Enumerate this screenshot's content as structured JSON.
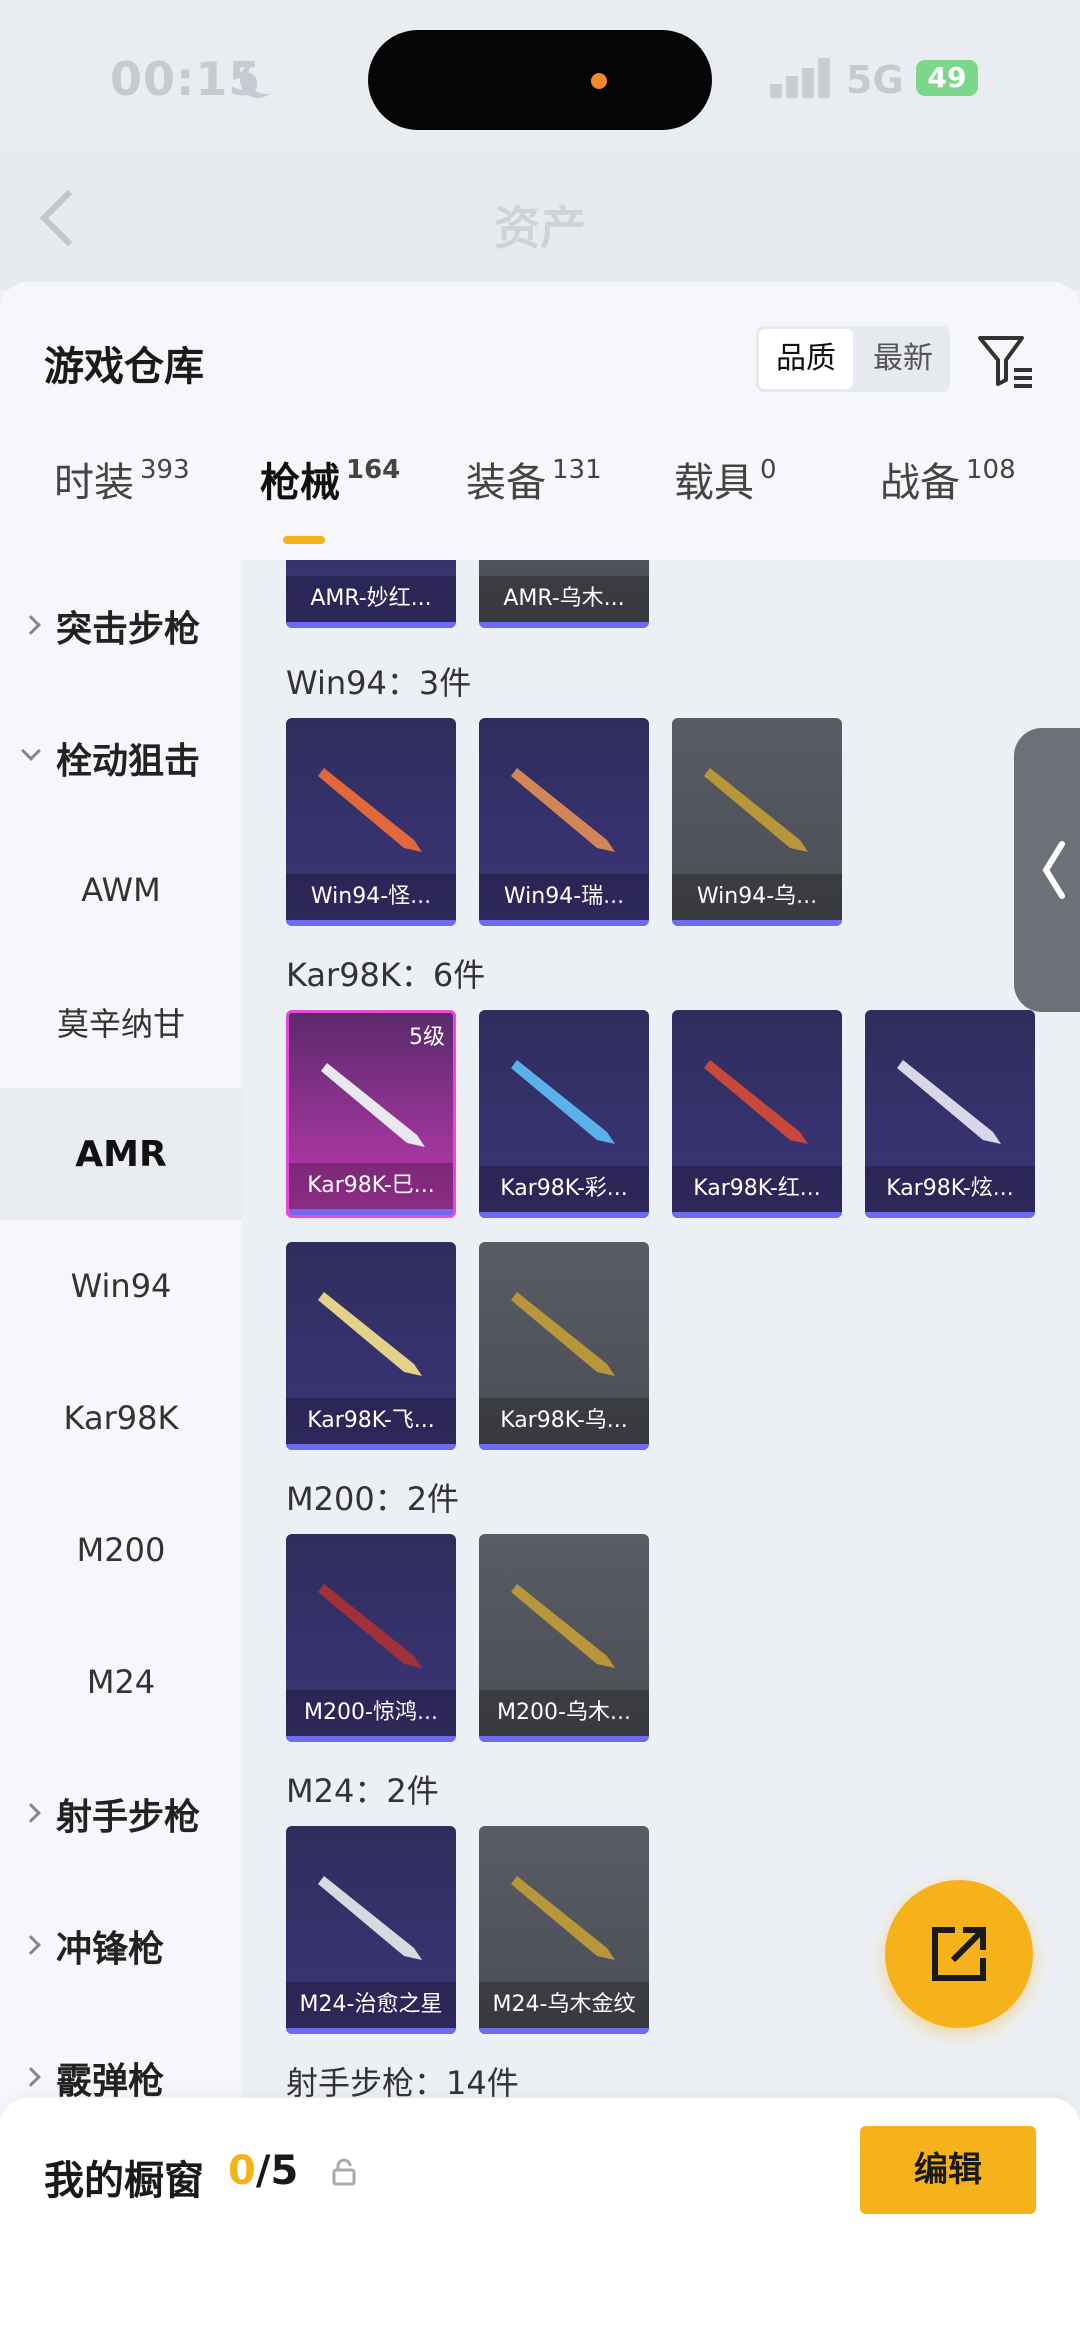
{
  "status": {
    "time": "00:15",
    "network": "5G",
    "battery": "49"
  },
  "header": {
    "title": "资产"
  },
  "sheet": {
    "title": "游戏仓库",
    "sort_options": [
      "品质",
      "最新"
    ]
  },
  "tabs": [
    {
      "label": "时装",
      "count": "393"
    },
    {
      "label": "枪械",
      "count": "164"
    },
    {
      "label": "装备",
      "count": "131"
    },
    {
      "label": "载具",
      "count": "0"
    },
    {
      "label": "战备",
      "count": "108"
    }
  ],
  "sidebar": [
    {
      "label": "突击步枪",
      "type": "group",
      "state": "collapsed"
    },
    {
      "label": "栓动狙击",
      "type": "group",
      "state": "expanded"
    },
    {
      "label": "AWM",
      "type": "sub"
    },
    {
      "label": "莫辛纳甘",
      "type": "sub"
    },
    {
      "label": "AMR",
      "type": "sub",
      "active": true
    },
    {
      "label": "Win94",
      "type": "sub"
    },
    {
      "label": "Kar98K",
      "type": "sub"
    },
    {
      "label": "M200",
      "type": "sub"
    },
    {
      "label": "M24",
      "type": "sub"
    },
    {
      "label": "射手步枪",
      "type": "group",
      "state": "collapsed"
    },
    {
      "label": "冲锋枪",
      "type": "group",
      "state": "collapsed"
    },
    {
      "label": "霰弹枪",
      "type": "group",
      "state": "collapsed"
    }
  ],
  "sections": [
    {
      "title": "",
      "items": [
        {
          "name": "AMR-妙红...",
          "tier": "purple"
        },
        {
          "name": "AMR-乌木...",
          "tier": "gray"
        }
      ]
    },
    {
      "title": "Win94：3件",
      "items": [
        {
          "name": "Win94-怪...",
          "tier": "purple"
        },
        {
          "name": "Win94-瑞...",
          "tier": "purple"
        },
        {
          "name": "Win94-乌...",
          "tier": "gray"
        }
      ]
    },
    {
      "title": "Kar98K：6件",
      "items": [
        {
          "name": "Kar98K-巳...",
          "tier": "pink",
          "level": "5级"
        },
        {
          "name": "Kar98K-彩...",
          "tier": "purple"
        },
        {
          "name": "Kar98K-红...",
          "tier": "purple"
        },
        {
          "name": "Kar98K-炫...",
          "tier": "purple"
        },
        {
          "name": "Kar98K-飞...",
          "tier": "purple"
        },
        {
          "name": "Kar98K-乌...",
          "tier": "gray"
        }
      ]
    },
    {
      "title": "M200：2件",
      "items": [
        {
          "name": "M200-惊鸿...",
          "tier": "purple"
        },
        {
          "name": "M200-乌木...",
          "tier": "gray"
        }
      ]
    },
    {
      "title": "M24：2件",
      "items": [
        {
          "name": "M24-治愈之星",
          "tier": "purple"
        },
        {
          "name": "M24-乌木金纹",
          "tier": "gray"
        }
      ]
    },
    {
      "title": "射手步枪：14件",
      "items": []
    }
  ],
  "showcase": {
    "label": "我的橱窗",
    "current": "0",
    "total": "/5",
    "edit_label": "编辑"
  },
  "colors": {
    "accent": "#f6b21a",
    "purple_card": "#3d357a",
    "gray_card": "#55575f",
    "pink_card": "#c03bb2"
  },
  "icons": [
    "moon-icon",
    "signal-icon",
    "battery-icon",
    "back-icon",
    "filter-icon",
    "expand-handle-icon",
    "share-icon",
    "lock-icon"
  ]
}
